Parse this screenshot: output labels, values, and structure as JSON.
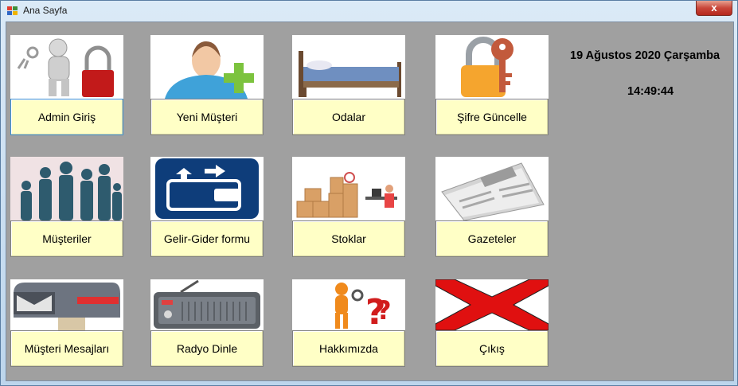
{
  "window": {
    "title": "Ana Sayfa",
    "close_glyph": "x"
  },
  "date_text": "19 Ağustos 2020 Çarşamba",
  "time_text": "14:49:44",
  "tiles": [
    {
      "label": "Admin Giriş",
      "icon": "admin-lock-icon"
    },
    {
      "label": "Yeni Müşteri",
      "icon": "add-user-icon"
    },
    {
      "label": "Odalar",
      "icon": "bed-icon"
    },
    {
      "label": "Şifre Güncelle",
      "icon": "padlock-key-icon"
    },
    {
      "label": "Müşteriler",
      "icon": "people-icon"
    },
    {
      "label": "Gelir-Gider formu",
      "icon": "wallet-icon"
    },
    {
      "label": "Stoklar",
      "icon": "boxes-icon"
    },
    {
      "label": "Gazeteler",
      "icon": "newspaper-icon"
    },
    {
      "label": "Müşteri Mesajları",
      "icon": "mailbox-icon"
    },
    {
      "label": "Radyo Dinle",
      "icon": "radio-icon"
    },
    {
      "label": "Hakkımızda",
      "icon": "question-figure-icon"
    },
    {
      "label": "Çıkış",
      "icon": "red-x-icon"
    }
  ],
  "colors": {
    "button_bg": "#ffffc6",
    "client_bg": "#a0a0a0",
    "close_red": "#c9473a"
  }
}
